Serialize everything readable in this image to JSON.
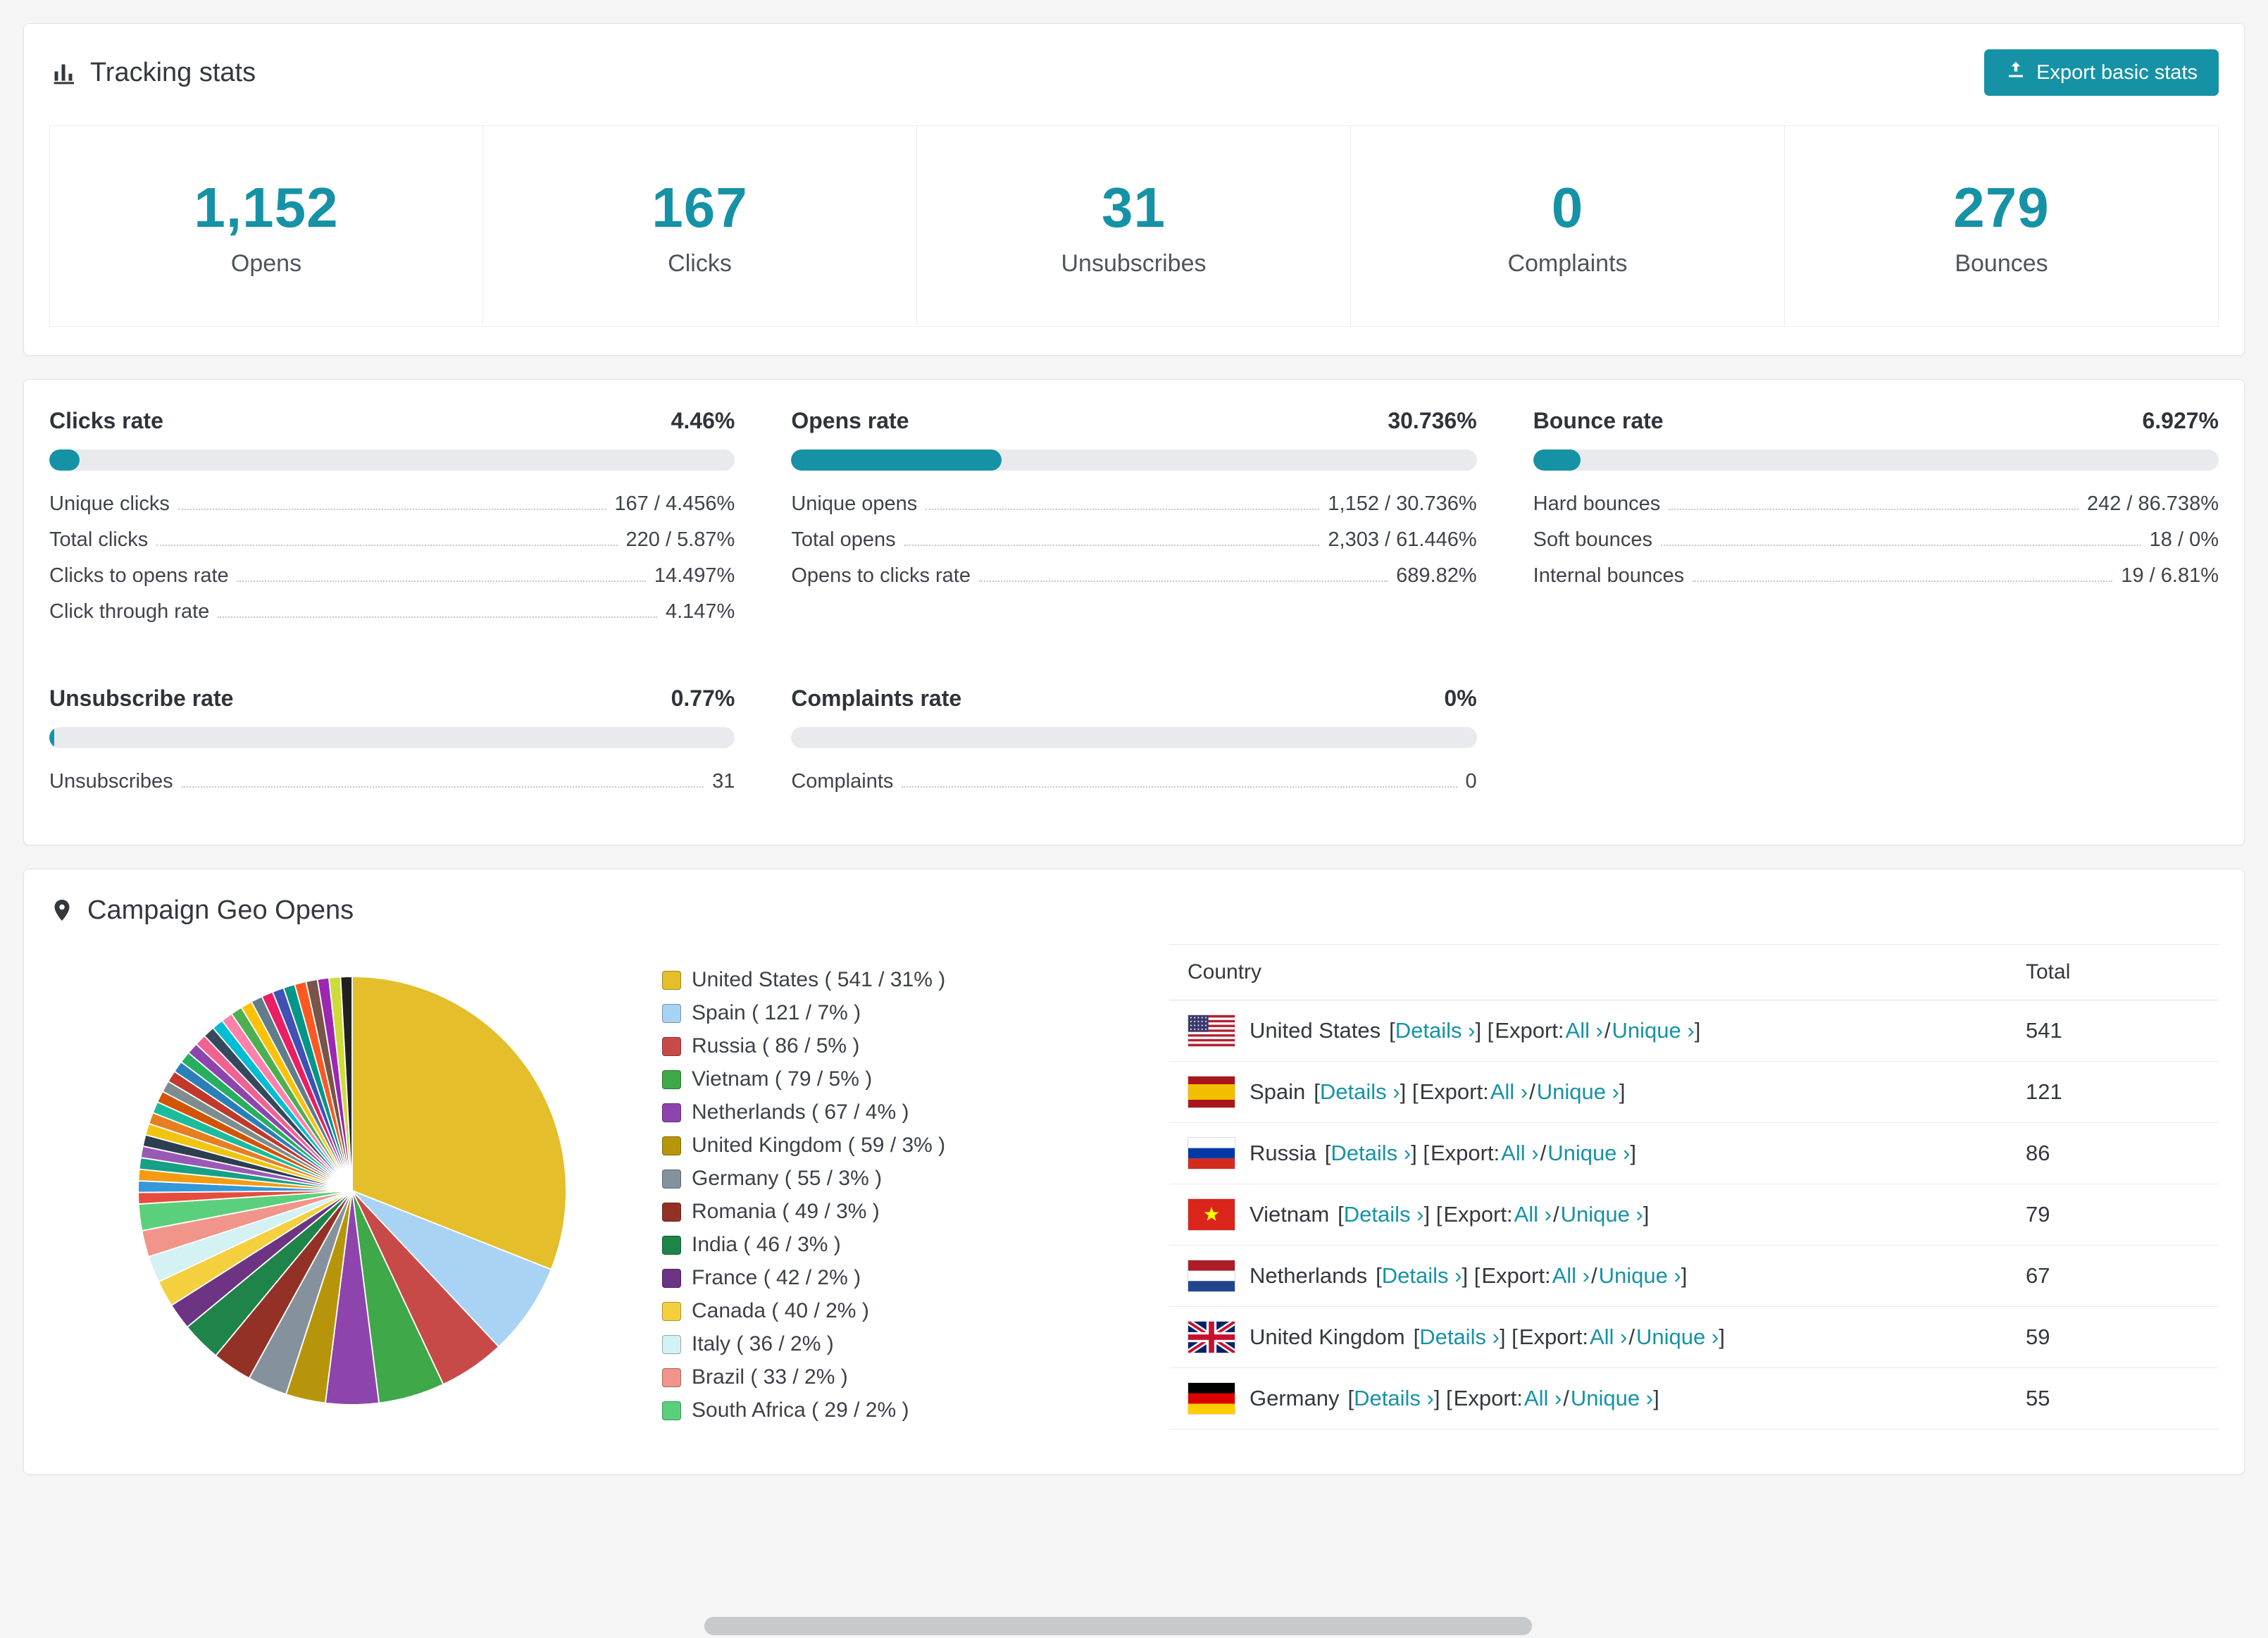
{
  "colors": {
    "accent": "#1692a6",
    "progress_track": "#e9eaed"
  },
  "tracking": {
    "title": "Tracking stats",
    "export_label": "Export basic stats",
    "stats": [
      {
        "value": "1,152",
        "label": "Opens"
      },
      {
        "value": "167",
        "label": "Clicks"
      },
      {
        "value": "31",
        "label": "Unsubscribes"
      },
      {
        "value": "0",
        "label": "Complaints"
      },
      {
        "value": "279",
        "label": "Bounces"
      }
    ]
  },
  "rates": [
    {
      "title": "Clicks rate",
      "percent_label": "4.46%",
      "bar_percent": 4.46,
      "rows": [
        {
          "label": "Unique clicks",
          "value": "167 / 4.456%"
        },
        {
          "label": "Total clicks",
          "value": "220 / 5.87%"
        },
        {
          "label": "Clicks to opens rate",
          "value": "14.497%"
        },
        {
          "label": "Click through rate",
          "value": "4.147%"
        }
      ]
    },
    {
      "title": "Opens rate",
      "percent_label": "30.736%",
      "bar_percent": 30.736,
      "rows": [
        {
          "label": "Unique opens",
          "value": "1,152 / 30.736%"
        },
        {
          "label": "Total opens",
          "value": "2,303 / 61.446%"
        },
        {
          "label": "Opens to clicks rate",
          "value": "689.82%"
        }
      ]
    },
    {
      "title": "Bounce rate",
      "percent_label": "6.927%",
      "bar_percent": 6.927,
      "rows": [
        {
          "label": "Hard bounces",
          "value": "242 / 86.738%"
        },
        {
          "label": "Soft bounces",
          "value": "18 / 0%"
        },
        {
          "label": "Internal bounces",
          "value": "19 / 6.81%"
        }
      ]
    },
    {
      "title": "Unsubscribe rate",
      "percent_label": "0.77%",
      "bar_percent": 0.77,
      "rows": [
        {
          "label": "Unsubscribes",
          "value": "31"
        }
      ]
    },
    {
      "title": "Complaints rate",
      "percent_label": "0%",
      "bar_percent": 0,
      "rows": [
        {
          "label": "Complaints",
          "value": "0"
        }
      ]
    }
  ],
  "geo": {
    "title": "Campaign Geo Opens",
    "table": {
      "country_header": "Country",
      "total_header": "Total",
      "details_label": "Details ›",
      "export_prefix": "Export: ",
      "all_label": "All ›",
      "unique_label": "Unique ›",
      "rows": [
        {
          "country": "United States",
          "flag": "us",
          "total": "541"
        },
        {
          "country": "Spain",
          "flag": "es",
          "total": "121"
        },
        {
          "country": "Russia",
          "flag": "ru",
          "total": "86"
        },
        {
          "country": "Vietnam",
          "flag": "vn",
          "total": "79"
        },
        {
          "country": "Netherlands",
          "flag": "nl",
          "total": "67"
        },
        {
          "country": "United Kingdom",
          "flag": "gb",
          "total": "59"
        },
        {
          "country": "Germany",
          "flag": "de",
          "total": "55"
        }
      ]
    }
  },
  "chart_data": {
    "type": "pie",
    "title": "Campaign Geo Opens",
    "unit": "opens",
    "legend_position": "right",
    "slices": [
      {
        "label": "United States",
        "value": 541,
        "percent": 31,
        "color": "#E4BE2B"
      },
      {
        "label": "Spain",
        "value": 121,
        "percent": 7,
        "color": "#A9D3F5"
      },
      {
        "label": "Russia",
        "value": 86,
        "percent": 5,
        "color": "#C74A48"
      },
      {
        "label": "Vietnam",
        "value": 79,
        "percent": 5,
        "color": "#3FA848"
      },
      {
        "label": "Netherlands",
        "value": 67,
        "percent": 4,
        "color": "#8E44AD"
      },
      {
        "label": "United Kingdom",
        "value": 59,
        "percent": 3,
        "color": "#B7950B"
      },
      {
        "label": "Germany",
        "value": 55,
        "percent": 3,
        "color": "#85929E"
      },
      {
        "label": "Romania",
        "value": 49,
        "percent": 3,
        "color": "#943126"
      },
      {
        "label": "India",
        "value": 46,
        "percent": 3,
        "color": "#1E8449"
      },
      {
        "label": "France",
        "value": 42,
        "percent": 2,
        "color": "#6C3483"
      },
      {
        "label": "Canada",
        "value": 40,
        "percent": 2,
        "color": "#F4D03F"
      },
      {
        "label": "Italy",
        "value": 36,
        "percent": 2,
        "color": "#D4F1F4"
      },
      {
        "label": "Brazil",
        "value": 33,
        "percent": 2,
        "color": "#F1948A"
      },
      {
        "label": "South Africa",
        "value": 29,
        "percent": 2,
        "color": "#5BD07C"
      }
    ],
    "others": {
      "percent_total": 26,
      "colors": [
        "#E74C3C",
        "#3498DB",
        "#F39C12",
        "#16A085",
        "#9B59B6",
        "#2C3E50",
        "#F1C40F",
        "#E67E22",
        "#1ABC9C",
        "#D35400",
        "#7F8C8D",
        "#C0392B",
        "#2980B9",
        "#27AE60",
        "#8E44AD",
        "#F06292",
        "#34495E",
        "#00BCD4",
        "#FF80AB",
        "#4CAF50",
        "#FFC107",
        "#607D8B",
        "#E91E63",
        "#3F51B5",
        "#009688",
        "#FF5722",
        "#795548",
        "#9C27B0",
        "#CDDC39",
        "#212121"
      ]
    }
  }
}
